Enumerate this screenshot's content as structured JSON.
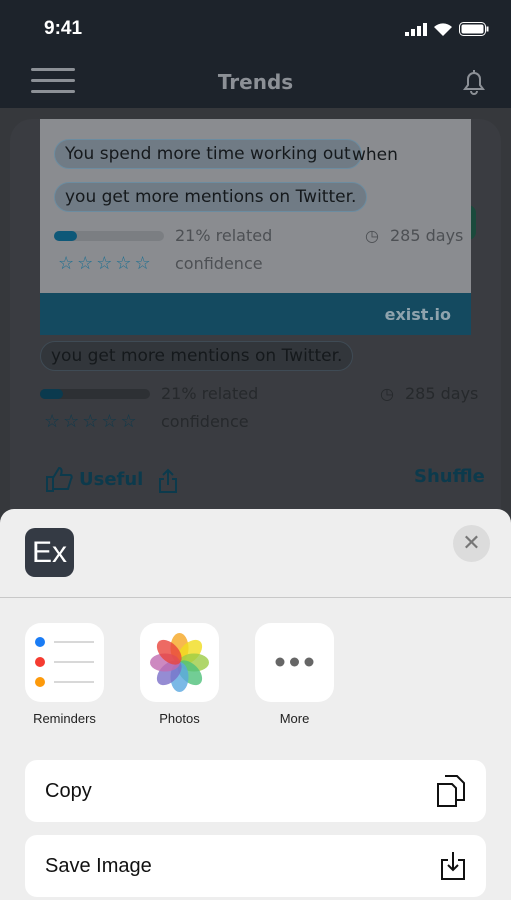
{
  "status_bar": {
    "time": "9:41"
  },
  "nav": {
    "title": "Trends",
    "menu_icon": "hamburger-icon",
    "bell_icon": "bell-icon"
  },
  "preview": {
    "subject": "You spend more time working out",
    "connector": "when",
    "condition": "you get more mentions on Twitter.",
    "related_percent": 21,
    "related_label": "21% related",
    "days_label": "285 days",
    "stars": "☆☆☆☆☆",
    "confidence_rating": 0,
    "confidence_label": "confidence",
    "brand": "exist.io"
  },
  "card": {
    "condition": "you get more mentions on Twitter.",
    "related_percent": 21,
    "related_label": "21% related",
    "days_label": "285 days",
    "stars": "☆☆☆☆☆",
    "confidence_label": "confidence",
    "useful_label": "Useful",
    "shuffle_label": "Shuffle"
  },
  "share_sheet": {
    "app_icon_text": "Ex",
    "targets": [
      {
        "label": "Reminders"
      },
      {
        "label": "Photos"
      },
      {
        "label": "More"
      }
    ],
    "actions": [
      {
        "label": "Copy",
        "icon": "copy-icon"
      },
      {
        "label": "Save Image",
        "icon": "save-image-icon"
      }
    ]
  }
}
